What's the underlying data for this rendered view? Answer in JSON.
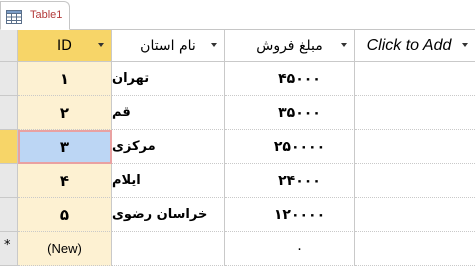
{
  "tab": {
    "label": "Table1",
    "icon": "table-icon"
  },
  "columns": [
    {
      "label": "ID"
    },
    {
      "label": "نام استان"
    },
    {
      "label": "مبلغ فروش"
    },
    {
      "label": "Click to Add"
    }
  ],
  "rows": [
    {
      "id": "۱",
      "province": "تهران",
      "sales": "۴۵۰۰۰"
    },
    {
      "id": "۲",
      "province": "قم",
      "sales": "۳۵۰۰۰"
    },
    {
      "id": "۳",
      "province": "مرکزی",
      "sales": "۲۵۰۰۰۰"
    },
    {
      "id": "۴",
      "province": "ایلام",
      "sales": "۲۴۰۰۰"
    },
    {
      "id": "۵",
      "province": "خراسان رضوی",
      "sales": "۱۲۰۰۰۰"
    }
  ],
  "new_row": {
    "id": "(New)",
    "sales": "۰",
    "marker": "*"
  },
  "colors": {
    "selected_header": "#f7d568",
    "selected_column": "#fdf1d2",
    "active_cell": "#bcd6f4",
    "active_cell_border": "#e9a1a1",
    "tab_text": "#b33a3a"
  }
}
